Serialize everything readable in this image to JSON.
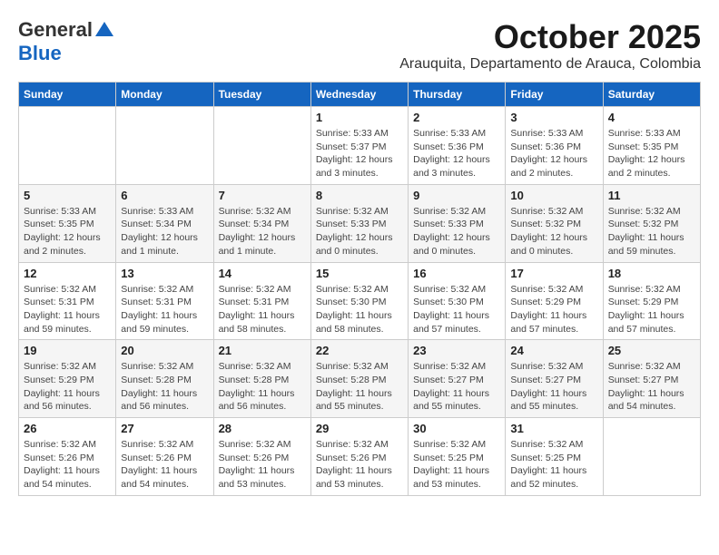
{
  "logo": {
    "general": "General",
    "blue": "Blue"
  },
  "title": {
    "month": "October 2025",
    "location": "Arauquita, Departamento de Arauca, Colombia"
  },
  "weekdays": [
    "Sunday",
    "Monday",
    "Tuesday",
    "Wednesday",
    "Thursday",
    "Friday",
    "Saturday"
  ],
  "weeks": [
    [
      {
        "day": "",
        "info": ""
      },
      {
        "day": "",
        "info": ""
      },
      {
        "day": "",
        "info": ""
      },
      {
        "day": "1",
        "info": "Sunrise: 5:33 AM\nSunset: 5:37 PM\nDaylight: 12 hours\nand 3 minutes."
      },
      {
        "day": "2",
        "info": "Sunrise: 5:33 AM\nSunset: 5:36 PM\nDaylight: 12 hours\nand 3 minutes."
      },
      {
        "day": "3",
        "info": "Sunrise: 5:33 AM\nSunset: 5:36 PM\nDaylight: 12 hours\nand 2 minutes."
      },
      {
        "day": "4",
        "info": "Sunrise: 5:33 AM\nSunset: 5:35 PM\nDaylight: 12 hours\nand 2 minutes."
      }
    ],
    [
      {
        "day": "5",
        "info": "Sunrise: 5:33 AM\nSunset: 5:35 PM\nDaylight: 12 hours\nand 2 minutes."
      },
      {
        "day": "6",
        "info": "Sunrise: 5:33 AM\nSunset: 5:34 PM\nDaylight: 12 hours\nand 1 minute."
      },
      {
        "day": "7",
        "info": "Sunrise: 5:32 AM\nSunset: 5:34 PM\nDaylight: 12 hours\nand 1 minute."
      },
      {
        "day": "8",
        "info": "Sunrise: 5:32 AM\nSunset: 5:33 PM\nDaylight: 12 hours\nand 0 minutes."
      },
      {
        "day": "9",
        "info": "Sunrise: 5:32 AM\nSunset: 5:33 PM\nDaylight: 12 hours\nand 0 minutes."
      },
      {
        "day": "10",
        "info": "Sunrise: 5:32 AM\nSunset: 5:32 PM\nDaylight: 12 hours\nand 0 minutes."
      },
      {
        "day": "11",
        "info": "Sunrise: 5:32 AM\nSunset: 5:32 PM\nDaylight: 11 hours\nand 59 minutes."
      }
    ],
    [
      {
        "day": "12",
        "info": "Sunrise: 5:32 AM\nSunset: 5:31 PM\nDaylight: 11 hours\nand 59 minutes."
      },
      {
        "day": "13",
        "info": "Sunrise: 5:32 AM\nSunset: 5:31 PM\nDaylight: 11 hours\nand 59 minutes."
      },
      {
        "day": "14",
        "info": "Sunrise: 5:32 AM\nSunset: 5:31 PM\nDaylight: 11 hours\nand 58 minutes."
      },
      {
        "day": "15",
        "info": "Sunrise: 5:32 AM\nSunset: 5:30 PM\nDaylight: 11 hours\nand 58 minutes."
      },
      {
        "day": "16",
        "info": "Sunrise: 5:32 AM\nSunset: 5:30 PM\nDaylight: 11 hours\nand 57 minutes."
      },
      {
        "day": "17",
        "info": "Sunrise: 5:32 AM\nSunset: 5:29 PM\nDaylight: 11 hours\nand 57 minutes."
      },
      {
        "day": "18",
        "info": "Sunrise: 5:32 AM\nSunset: 5:29 PM\nDaylight: 11 hours\nand 57 minutes."
      }
    ],
    [
      {
        "day": "19",
        "info": "Sunrise: 5:32 AM\nSunset: 5:29 PM\nDaylight: 11 hours\nand 56 minutes."
      },
      {
        "day": "20",
        "info": "Sunrise: 5:32 AM\nSunset: 5:28 PM\nDaylight: 11 hours\nand 56 minutes."
      },
      {
        "day": "21",
        "info": "Sunrise: 5:32 AM\nSunset: 5:28 PM\nDaylight: 11 hours\nand 56 minutes."
      },
      {
        "day": "22",
        "info": "Sunrise: 5:32 AM\nSunset: 5:28 PM\nDaylight: 11 hours\nand 55 minutes."
      },
      {
        "day": "23",
        "info": "Sunrise: 5:32 AM\nSunset: 5:27 PM\nDaylight: 11 hours\nand 55 minutes."
      },
      {
        "day": "24",
        "info": "Sunrise: 5:32 AM\nSunset: 5:27 PM\nDaylight: 11 hours\nand 55 minutes."
      },
      {
        "day": "25",
        "info": "Sunrise: 5:32 AM\nSunset: 5:27 PM\nDaylight: 11 hours\nand 54 minutes."
      }
    ],
    [
      {
        "day": "26",
        "info": "Sunrise: 5:32 AM\nSunset: 5:26 PM\nDaylight: 11 hours\nand 54 minutes."
      },
      {
        "day": "27",
        "info": "Sunrise: 5:32 AM\nSunset: 5:26 PM\nDaylight: 11 hours\nand 54 minutes."
      },
      {
        "day": "28",
        "info": "Sunrise: 5:32 AM\nSunset: 5:26 PM\nDaylight: 11 hours\nand 53 minutes."
      },
      {
        "day": "29",
        "info": "Sunrise: 5:32 AM\nSunset: 5:26 PM\nDaylight: 11 hours\nand 53 minutes."
      },
      {
        "day": "30",
        "info": "Sunrise: 5:32 AM\nSunset: 5:25 PM\nDaylight: 11 hours\nand 53 minutes."
      },
      {
        "day": "31",
        "info": "Sunrise: 5:32 AM\nSunset: 5:25 PM\nDaylight: 11 hours\nand 52 minutes."
      },
      {
        "day": "",
        "info": ""
      }
    ]
  ]
}
